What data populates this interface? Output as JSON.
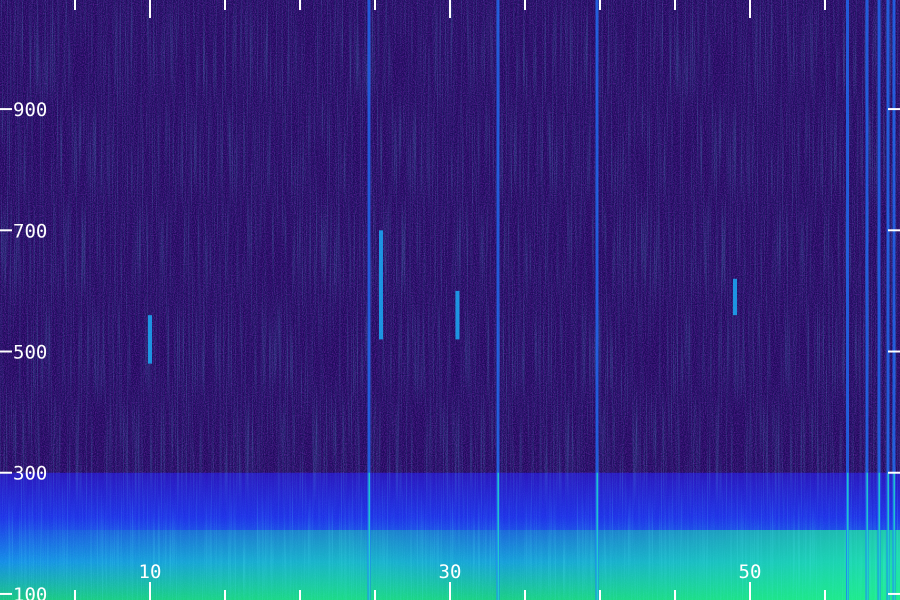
{
  "chart_data": {
    "type": "heatmap",
    "title": "",
    "xlabel": "",
    "ylabel": "",
    "x_tick_labels": [
      "10",
      "30",
      "50"
    ],
    "x_tick_values": [
      10,
      30,
      50
    ],
    "y_tick_labels": [
      "100",
      "300",
      "500",
      "700",
      "900"
    ],
    "y_tick_values": [
      100,
      300,
      500,
      700,
      900
    ],
    "xlim": [
      0,
      60
    ],
    "ylim": [
      90,
      1080
    ],
    "colormap": [
      "#1a0a4a",
      "#2a10a0",
      "#1a40ff",
      "#10b0ff",
      "#20ff90"
    ],
    "grid": false,
    "bands": [
      {
        "y_from": 90,
        "y_to": 300,
        "intensity": "high"
      },
      {
        "y_from": 300,
        "y_to": 1080,
        "intensity": "low"
      }
    ],
    "vertical_lines_x": [
      33.2,
      39.8,
      24.6,
      56.5,
      57.8,
      58.6,
      59.2,
      59.6
    ],
    "patches": [
      {
        "x": 25.4,
        "y_from": 520,
        "y_to": 700
      },
      {
        "x": 30.5,
        "y_from": 520,
        "y_to": 600
      },
      {
        "x": 10.0,
        "y_from": 480,
        "y_to": 560
      },
      {
        "x": 49.0,
        "y_from": 560,
        "y_to": 620
      }
    ]
  }
}
